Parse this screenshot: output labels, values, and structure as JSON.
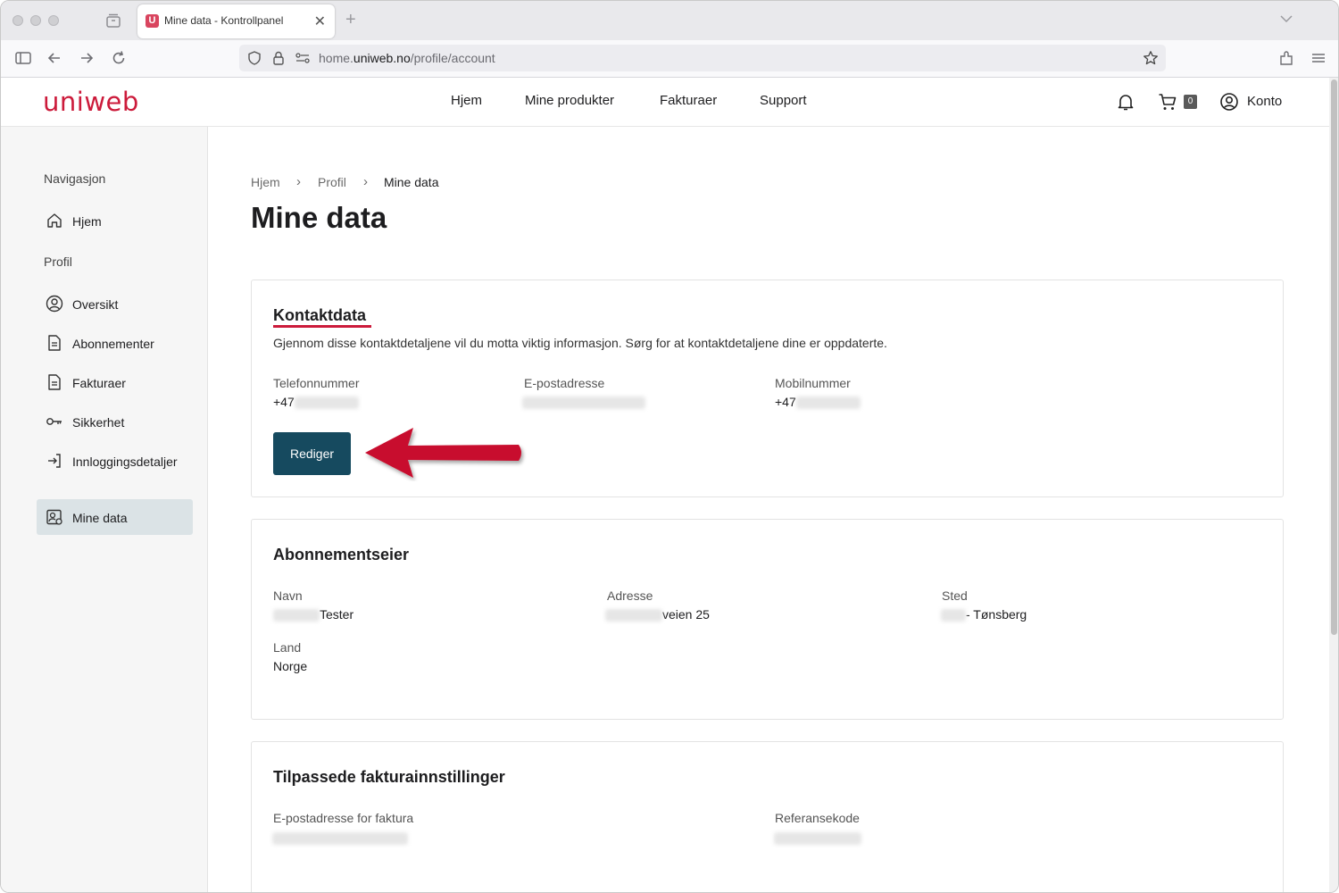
{
  "browser": {
    "tab_title": "Mine data - Kontrollpanel",
    "tab_favicon": "U",
    "tab_close": "✕",
    "new_tab": "+",
    "url_prefix": "home.",
    "url_host": "uniweb.no",
    "url_path": "/profile/account"
  },
  "header": {
    "logo": "uniweb",
    "menu": [
      "Hjem",
      "Mine produkter",
      "Fakturaer",
      "Support"
    ],
    "cart_count": "0",
    "account_label": "Konto"
  },
  "sidebar": {
    "nav_heading": "Navigasjon",
    "home_item": "Hjem",
    "profile_heading": "Profil",
    "items": [
      "Oversikt",
      "Abonnementer",
      "Fakturaer",
      "Sikkerhet",
      "Innloggingsdetaljer",
      "Mine data"
    ]
  },
  "breadcrumb": {
    "items": [
      "Hjem",
      "Profil",
      "Mine data"
    ],
    "separator": "›"
  },
  "page": {
    "title": "Mine data"
  },
  "contact": {
    "title": "Kontaktdata",
    "description": "Gjennom disse kontaktdetaljene vil du motta viktig informasjon. Sørg for at kontaktdetaljene dine er oppdaterte.",
    "phone_label": "Telefonnummer",
    "phone_value": "+47",
    "email_label": "E-postadresse",
    "mobile_label": "Mobilnummer",
    "mobile_value": "+47",
    "edit_button": "Rediger"
  },
  "owner": {
    "title": "Abonnementseier",
    "name_label": "Navn",
    "name_value": "Tester",
    "address_label": "Adresse",
    "address_value": "veien 25",
    "place_label": "Sted",
    "place_value": "- Tønsberg",
    "country_label": "Land",
    "country_value": "Norge"
  },
  "billing": {
    "title": "Tilpassede fakturainnstillinger",
    "email_label": "E-postadresse for faktura",
    "ref_label": "Referansekode"
  },
  "colors": {
    "brand": "#cc1b3b",
    "button": "#164a5f",
    "active_nav": "#dbe3e6",
    "arrow": "#c8102e"
  }
}
